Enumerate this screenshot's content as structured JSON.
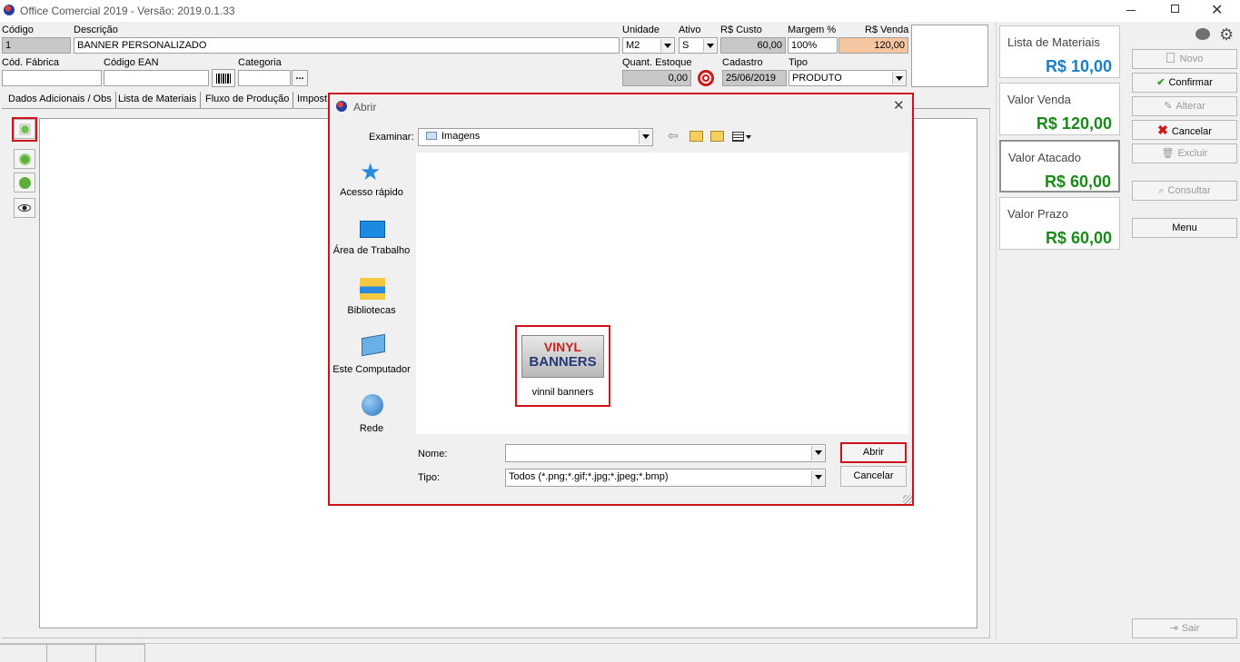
{
  "window": {
    "title": "Office Comercial 2019 - Versão: 2019.0.1.33"
  },
  "form": {
    "codigo_label": "Código",
    "codigo": "1",
    "descricao_label": "Descrição",
    "descricao": "BANNER PERSONALIZADO",
    "unidade_label": "Unidade",
    "unidade": "M2",
    "ativo_label": "Ativo",
    "ativo": "S",
    "custo_label": "R$ Custo",
    "custo": "60,00",
    "margem_label": "Margem %",
    "margem": "100%",
    "venda_label": "R$ Venda",
    "venda": "120,00",
    "cod_fabrica_label": "Cód. Fábrica",
    "cod_fabrica": "",
    "ean_label": "Código EAN",
    "ean": "",
    "categoria_label": "Categoria",
    "categoria": "",
    "categoria_btn": "...",
    "estoque_label": "Quant. Estoque",
    "estoque": "0,00",
    "cadastro_label": "Cadastro",
    "cadastro": "25/06/2019",
    "tipo_label": "Tipo",
    "tipo": "PRODUTO"
  },
  "tabs": [
    "Dados Adicionais / Obs",
    "Lista de Materiais",
    "Fluxo de Produção",
    "Impost"
  ],
  "cards": [
    {
      "title": "Lista de Materiais",
      "value": "R$ 10,00",
      "color": "#1a7fc9"
    },
    {
      "title": "Valor Venda",
      "value": "R$ 120,00",
      "color": "#1a8a1a"
    },
    {
      "title": "Valor Atacado",
      "value": "R$ 60,00",
      "color": "#1a8a1a"
    },
    {
      "title": "Valor Prazo",
      "value": "R$ 60,00",
      "color": "#1a8a1a"
    }
  ],
  "actions": {
    "novo": "Novo",
    "confirmar": "Confirmar",
    "alterar": "Alterar",
    "cancelar": "Cancelar",
    "excluir": "Excluir",
    "consultar": "Consultar",
    "menu": "Menu",
    "sair": "Sair"
  },
  "dialog": {
    "title": "Abrir",
    "examinar_label": "Examinar:",
    "examinar_value": "Imagens",
    "nav": [
      "Acesso rápido",
      "Área de Trabalho",
      "Bibliotecas",
      "Este Computador",
      "Rede"
    ],
    "file": {
      "name": "vinnil banners",
      "thumb_line1": "VINYL",
      "thumb_line2": "BANNERS"
    },
    "nome_label": "Nome:",
    "nome_value": "",
    "tipo_label": "Tipo:",
    "tipo_value": "Todos (*.png;*.gif;*.jpg;*.jpeg;*.bmp)",
    "abrir": "Abrir",
    "cancelar": "Cancelar"
  },
  "colors": {
    "highlight": "#d0101a",
    "blue_value": "#1a7fc9",
    "green_value": "#1a8a1a"
  }
}
